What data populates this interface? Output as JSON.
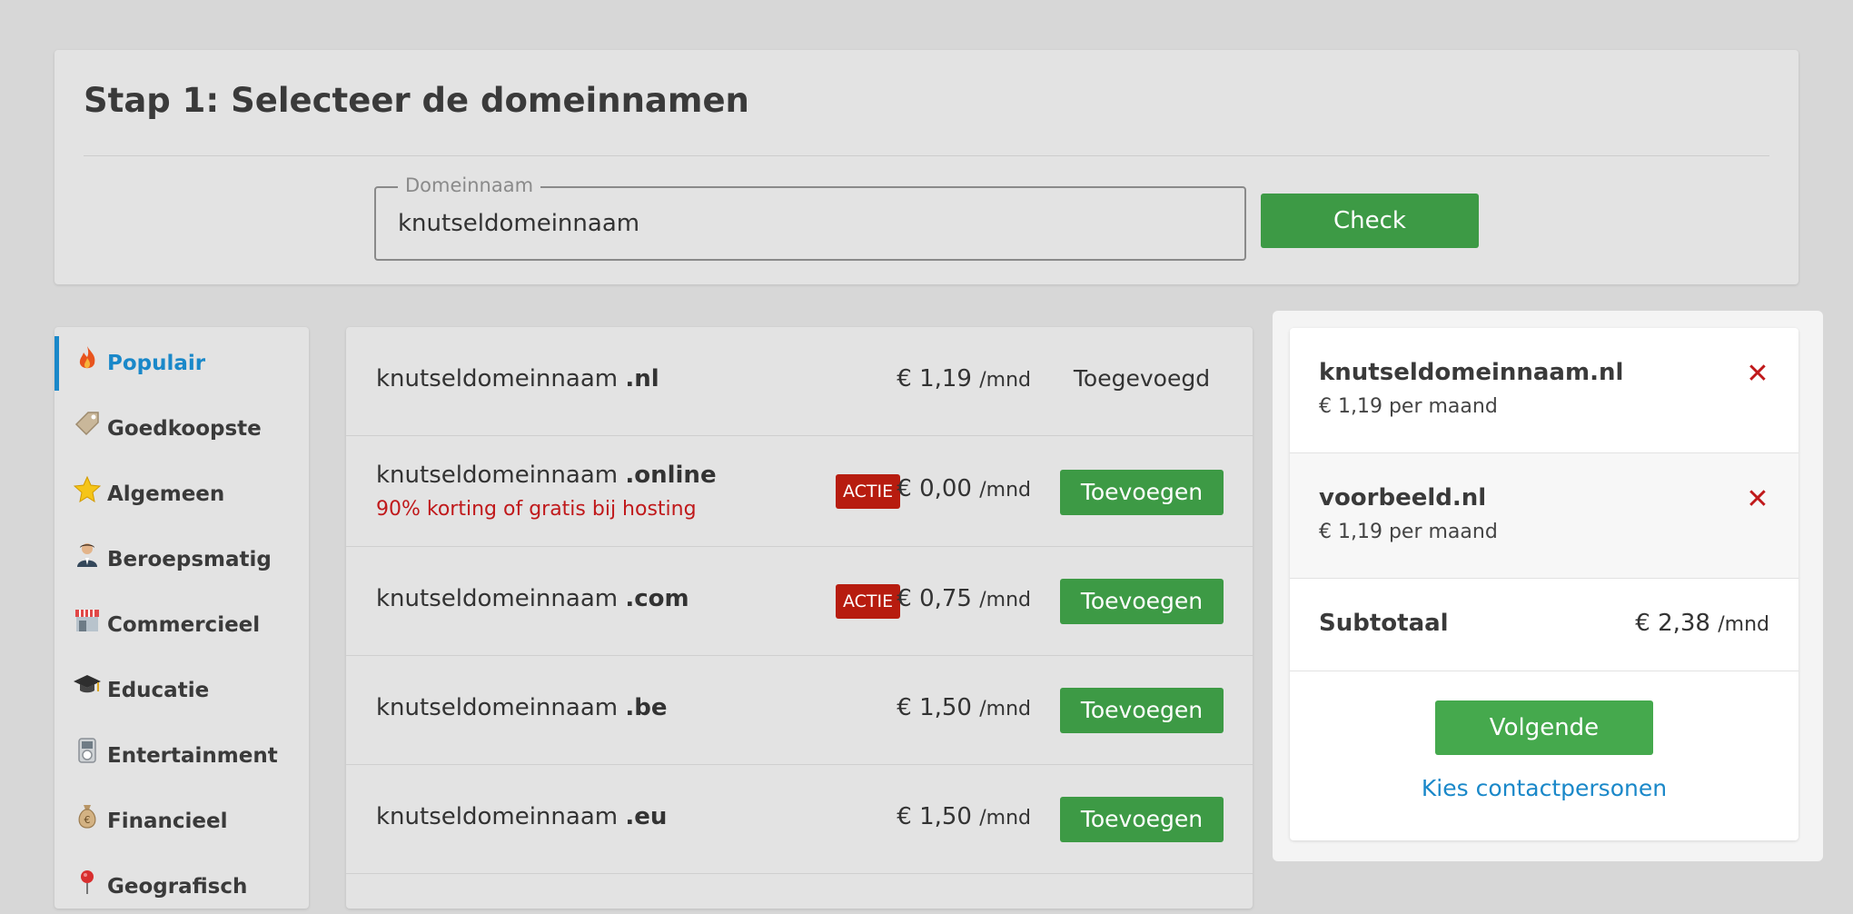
{
  "step": {
    "title": "Stap 1: Selecteer de domeinnamen",
    "field_legend": "Domeinnaam",
    "field_value": "knutseldomeinnaam",
    "check_label": "Check"
  },
  "sidebar": {
    "accent_color": "#1a88c9",
    "items": [
      {
        "label": "Populair",
        "icon": "flame-icon",
        "active": true
      },
      {
        "label": "Goedkoopste",
        "icon": "price-tag-icon",
        "active": false
      },
      {
        "label": "Algemeen",
        "icon": "star-icon",
        "active": false
      },
      {
        "label": "Beroepsmatig",
        "icon": "business-person-icon",
        "active": false
      },
      {
        "label": "Commercieel",
        "icon": "shop-icon",
        "active": false
      },
      {
        "label": "Educatie",
        "icon": "graduation-cap-icon",
        "active": false
      },
      {
        "label": "Entertainment",
        "icon": "music-player-icon",
        "active": false
      },
      {
        "label": "Financieel",
        "icon": "money-bag-icon",
        "active": false
      },
      {
        "label": "Geografisch",
        "icon": "map-pin-icon",
        "active": false
      }
    ]
  },
  "results": {
    "rows": [
      {
        "base": "knutseldomeinnaam",
        "tld": ".nl",
        "price": "€ 1,19",
        "per": "/mnd",
        "badge": "",
        "promo": "",
        "action": "Toegevoegd",
        "added": true
      },
      {
        "base": "knutseldomeinnaam",
        "tld": ".online",
        "price": "€ 0,00",
        "per": "/mnd",
        "badge": "ACTIE",
        "promo": "90% korting of gratis bij hosting",
        "action": "Toevoegen",
        "added": false
      },
      {
        "base": "knutseldomeinnaam",
        "tld": ".com",
        "price": "€ 0,75",
        "per": "/mnd",
        "badge": "ACTIE",
        "promo": "",
        "action": "Toevoegen",
        "added": false
      },
      {
        "base": "knutseldomeinnaam",
        "tld": ".be",
        "price": "€ 1,50",
        "per": "/mnd",
        "badge": "",
        "promo": "",
        "action": "Toevoegen",
        "added": false
      },
      {
        "base": "knutseldomeinnaam",
        "tld": ".eu",
        "price": "€ 1,50",
        "per": "/mnd",
        "badge": "",
        "promo": "",
        "action": "Toevoegen",
        "added": false
      }
    ]
  },
  "cart": {
    "items": [
      {
        "name": "knutseldomeinnaam.nl",
        "price": "€ 1,19 per maand",
        "remove_icon": "close-icon"
      },
      {
        "name": "voorbeeld.nl",
        "price": "€ 1,19 per maand",
        "remove_icon": "close-icon"
      }
    ],
    "subtotal_label": "Subtotaal",
    "subtotal_value": "€ 2,38",
    "subtotal_per": "/mnd",
    "next_label": "Volgende",
    "contact_link": "Kies contactpersonen"
  },
  "colors": {
    "primary_green": "#3d9a45",
    "link_blue": "#1a88c9",
    "action_red": "#b71c0f"
  }
}
